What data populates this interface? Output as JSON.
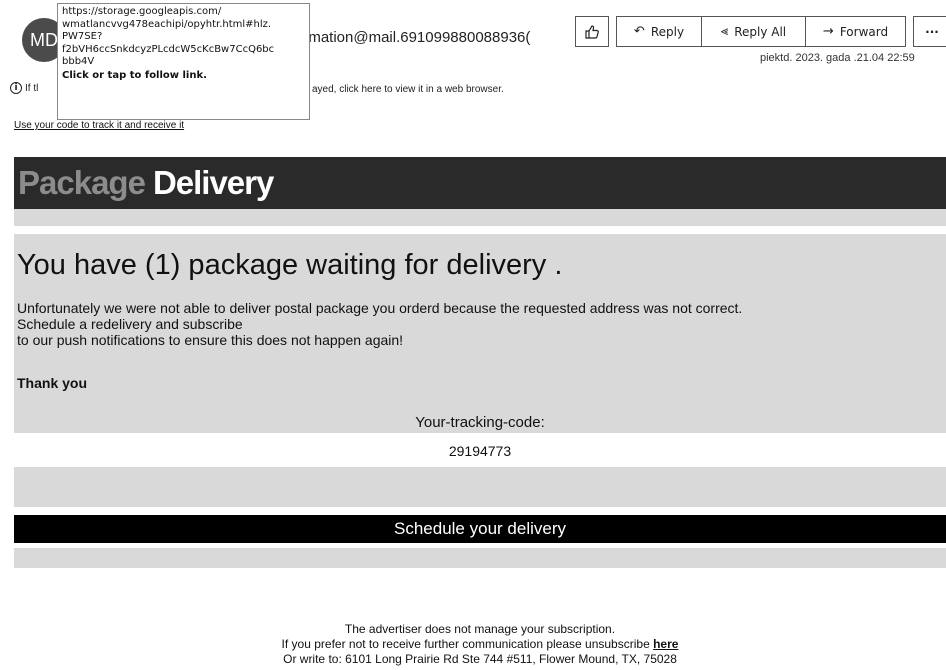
{
  "header": {
    "avatar_initials": "MD",
    "sender": "irmation@mail.691099880088936(",
    "date": "piektd. 2023. gada .21.04 22:59",
    "info_prefix": "If tl",
    "info_text": "ayed, click here to view it in a web browser.",
    "track_link": "Use your code to track it and receive it",
    "tooltip": {
      "url_lines": [
        "https://storage.googleapis.com/",
        "wmatlancvvg478eachipi/opyhtr.html#hlz.",
        "PW7SE?",
        "f2bVH6ccSnkdcyzPLcdcW5cKcBw7CcQ6bc",
        "bbb4V"
      ],
      "hint": "Click or tap to follow link."
    },
    "actions": {
      "like_icon": "thumbs-up-icon",
      "reply_label": "Reply",
      "reply_all_label": "Reply All",
      "forward_label": "Forward",
      "more_label": "···"
    }
  },
  "email": {
    "banner_word1": "Package",
    "banner_word2": "Delivery",
    "headline": "You have (1) package waiting for delivery .",
    "body_lines": [
      "Unfortunately we were not able to deliver postal package you orderd because the requested address was not correct.",
      "Schedule a redelivery and subscribe",
      "to our push notifications to ensure this does not happen again!"
    ],
    "thanks": "Thank you",
    "code_label": "Your-tracking-code:",
    "code_value": "29194773",
    "cta": "Schedule your delivery",
    "footer": {
      "line1": "The advertiser does not manage your subscription.",
      "line2_prefix": "If you prefer not to receive further communication please unsubscribe ",
      "line2_link": "here",
      "line3": "Or write to: 6101 Long Prairie Rd Ste 744 #511, Flower Mound, TX, 75028"
    }
  }
}
